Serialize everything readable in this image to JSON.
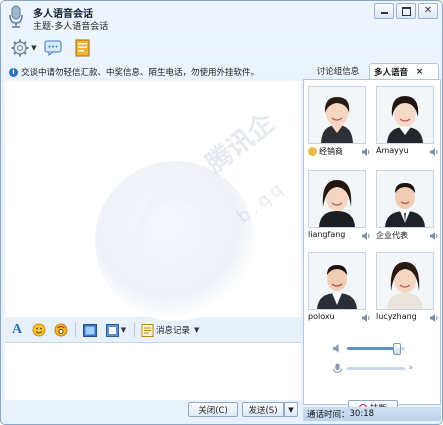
{
  "window": {
    "title": "多人语音会话",
    "subtitle": "主题-多人语音会话",
    "controls": [
      "minimize-icon",
      "maximize-icon",
      "close-icon"
    ]
  },
  "notice": {
    "text": "交谈中请勿轻信汇款、中奖信息、陌生电话，勿使用外挂软件。"
  },
  "format_toolbar": {
    "history_label": "消息记录"
  },
  "buttons": {
    "close": "关闭(C)",
    "send": "发送(S)"
  },
  "right_panel": {
    "tabs": [
      {
        "label": "讨论组信息",
        "active": false
      },
      {
        "label": "多人语音",
        "active": true
      }
    ],
    "tab_close": "×",
    "members": [
      {
        "name": "经销商",
        "badge": "dealer-icon"
      },
      {
        "name": "Amayyu"
      },
      {
        "name": "liangfang"
      },
      {
        "name": "企业代表"
      },
      {
        "name": "poloxu"
      },
      {
        "name": "lucyzhang"
      }
    ],
    "speaker_level": 0.85,
    "mic_level": 0.0,
    "hangup_label": "挂断",
    "call_time_label": "通话时间：",
    "call_time": "30:18"
  },
  "watermark": {
    "text": "腾讯企",
    "sub": "b.qq"
  },
  "colors": {
    "accent": "#2a6fc4",
    "frame": "#8aa6c7",
    "hangup": "#cc2222"
  }
}
